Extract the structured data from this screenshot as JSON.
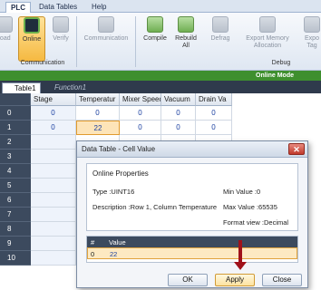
{
  "ribbon_tabs": [
    "PLC",
    "Data Tables",
    "Help"
  ],
  "ribbon": {
    "buttons": [
      {
        "label": "load",
        "icon": "download-icon"
      },
      {
        "label": "Online",
        "icon": "monitor-icon"
      },
      {
        "label": "Verify",
        "icon": "verify-check-icon"
      },
      {
        "label": "Communication",
        "icon": "communication-icon"
      },
      {
        "label": "Compile",
        "icon": "compile-arrow-icon"
      },
      {
        "label": "Rebuild All",
        "icon": "rebuild-arrows-icon"
      },
      {
        "label": "Defrag",
        "icon": "defrag-icon"
      },
      {
        "label": "Export Memory Allocation",
        "icon": "export-memory-icon"
      },
      {
        "label": "Expo Tag",
        "icon": "export-tags-icon"
      }
    ],
    "groups": [
      "Communication",
      "Debug"
    ]
  },
  "mode_text": "Online Mode",
  "doc_tabs": [
    "Table1",
    "Function1"
  ],
  "grid": {
    "columns": [
      "Stage",
      "Temperatur",
      "Mixer Speed",
      "Vacuum",
      "Drain Va"
    ],
    "rows": [
      {
        "n": "0",
        "vals": [
          "0",
          "0",
          "0",
          "0",
          "0"
        ]
      },
      {
        "n": "1",
        "vals": [
          "0",
          "22",
          "0",
          "0",
          "0"
        ]
      },
      {
        "n": "2",
        "vals": [
          "",
          "",
          "",
          "",
          ""
        ]
      },
      {
        "n": "3",
        "vals": [
          "",
          "",
          "",
          "",
          ""
        ]
      },
      {
        "n": "4",
        "vals": [
          "",
          "",
          "",
          "",
          ""
        ]
      },
      {
        "n": "5",
        "vals": [
          "",
          "",
          "",
          "",
          ""
        ]
      },
      {
        "n": "6",
        "vals": [
          "",
          "",
          "",
          "",
          ""
        ]
      },
      {
        "n": "7",
        "vals": [
          "",
          "",
          "",
          "",
          ""
        ]
      },
      {
        "n": "8",
        "vals": [
          "",
          "",
          "",
          "",
          ""
        ]
      },
      {
        "n": "9",
        "vals": [
          "",
          "",
          "",
          "",
          ""
        ]
      },
      {
        "n": "10",
        "vals": [
          "",
          "",
          "",
          "",
          ""
        ]
      }
    ]
  },
  "dialog": {
    "title": "Data Table - Cell Value",
    "props_header": "Online Properties",
    "type": "Type :UINT16",
    "min": "Min Value :0",
    "description": "Description :Row 1, Column Temperature",
    "max": "Max Value :65535",
    "format": "Format view :Decimal",
    "value_cols": [
      "#",
      "Value"
    ],
    "value_row": {
      "n": "0",
      "value": "22"
    },
    "buttons": [
      "OK",
      "Apply",
      "Close"
    ]
  },
  "colors": {
    "mode_bar": "#3e8f2e",
    "accent": "#f5b941",
    "arrow": "#a0111a"
  }
}
